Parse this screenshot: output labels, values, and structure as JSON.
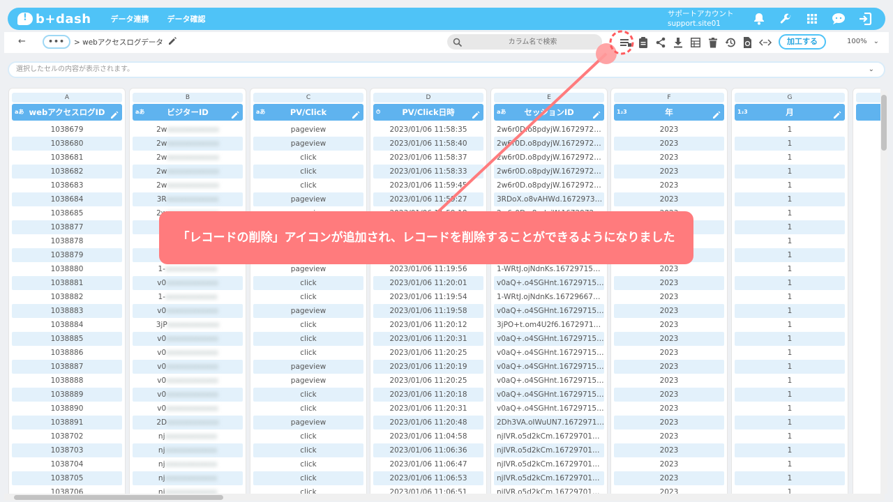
{
  "header": {
    "logo_text": "b+dash",
    "nav": [
      "データ連携",
      "データ確認"
    ],
    "account_name": "サポートアカウント",
    "account_site": "support.site01",
    "icons": [
      "bell-icon",
      "wrench-icon",
      "apps-grid-icon",
      "chat-support-icon",
      "logout-icon"
    ]
  },
  "toolbar": {
    "back_label": "←",
    "more_label": "•••",
    "breadcrumb": "> webアクセスログデータ",
    "search_placeholder": "カラム名で検索",
    "tool_icons": [
      "record-delete-icon",
      "clipboard-icon",
      "share-icon",
      "download-icon",
      "table-view-icon",
      "trash-icon",
      "history-icon",
      "refresh-file-icon",
      "code-icon"
    ],
    "process_label": "加工する",
    "zoom": "100%"
  },
  "cell_bar": {
    "placeholder": "選択したセルの内容が表示されます。"
  },
  "accent_colors": {
    "header_blue": "#4fc3f7",
    "column_header": "#5fb3ef",
    "callout": "#ff7b7d"
  },
  "grid": {
    "columns": [
      {
        "letter": "A",
        "type": "aあ",
        "name": "webアクセスログID"
      },
      {
        "letter": "B",
        "type": "aあ",
        "name": "ビジターID"
      },
      {
        "letter": "C",
        "type": "aあ",
        "name": "PV/Click"
      },
      {
        "letter": "D",
        "type": "⏱",
        "name": "PV/Click日時"
      },
      {
        "letter": "E",
        "type": "aあ",
        "name": "セッションID"
      },
      {
        "letter": "F",
        "type": "1₂3",
        "name": "年"
      },
      {
        "letter": "G",
        "type": "1₂3",
        "name": "月"
      }
    ],
    "rows": [
      [
        "1038679",
        "2w",
        "pageview",
        "2023/01/06 11:58:35",
        "2w6r0D.o8pdyjW.167297213...",
        "2023",
        "1"
      ],
      [
        "1038680",
        "2w",
        "pageview",
        "2023/01/06 11:58:40",
        "2w6r0D.o8pdyjW.167297213...",
        "2023",
        "1"
      ],
      [
        "1038681",
        "2w",
        "click",
        "2023/01/06 11:58:37",
        "2w6r0D.o8pdyjW.167297213...",
        "2023",
        "1"
      ],
      [
        "1038682",
        "2w",
        "click",
        "2023/01/06 11:58:33",
        "2w6r0D.o8pdyjW.167297213...",
        "2023",
        "1"
      ],
      [
        "1038683",
        "2w",
        "click",
        "2023/01/06 11:59:45",
        "2w6r0D.o8pdyjW.167297213...",
        "2023",
        "1"
      ],
      [
        "1038684",
        "3R",
        "pageview",
        "2023/01/06 11:59:27",
        "3RDoX.o8vAHWd.167297394...",
        "2023",
        "1"
      ],
      [
        "1038685",
        "2w",
        "pageview",
        "2023/01/06 11:59:18",
        "2w6r0D.o8pdyjW.167297213...",
        "2023",
        "1"
      ],
      [
        "1038877",
        "",
        "",
        "",
        "",
        "",
        "1"
      ],
      [
        "1038878",
        "",
        "",
        "",
        "",
        "",
        "1"
      ],
      [
        "1038879",
        "",
        "",
        "",
        "",
        "",
        "1"
      ],
      [
        "1038880",
        "1-",
        "pageview",
        "2023/01/06 11:19:56",
        "1-WRtJ.ojNdnKs.167297158...",
        "2023",
        "1"
      ],
      [
        "1038881",
        "v0",
        "click",
        "2023/01/06 11:20:01",
        "v0aQ+.o4SGHnt.167297159...",
        "2023",
        "1"
      ],
      [
        "1038882",
        "1-",
        "click",
        "2023/01/06 11:19:54",
        "1-WRtJ.ojNdnKs.167296672...",
        "2023",
        "1"
      ],
      [
        "1038883",
        "v0",
        "pageview",
        "2023/01/06 11:19:58",
        "v0aQ+.o4SGHnt.167297159...",
        "2023",
        "1"
      ],
      [
        "1038884",
        "3jP",
        "click",
        "2023/01/06 11:20:12",
        "3jPO+t.om4U2f6.16729715...",
        "2023",
        "1"
      ],
      [
        "1038885",
        "v0",
        "click",
        "2023/01/06 11:20:31",
        "v0aQ+.o4SGHnt.167297159...",
        "2023",
        "1"
      ],
      [
        "1038886",
        "v0",
        "click",
        "2023/01/06 11:20:25",
        "v0aQ+.o4SGHnt.167297159...",
        "2023",
        "1"
      ],
      [
        "1038887",
        "v0",
        "pageview",
        "2023/01/06 11:20:19",
        "v0aQ+.o4SGHnt.167297159...",
        "2023",
        "1"
      ],
      [
        "1038888",
        "v0",
        "pageview",
        "2023/01/06 11:20:25",
        "v0aQ+.o4SGHnt.167297159...",
        "2023",
        "1"
      ],
      [
        "1038889",
        "v0",
        "click",
        "2023/01/06 11:20:18",
        "v0aQ+.o4SGHnt.167297159...",
        "2023",
        "1"
      ],
      [
        "1038890",
        "v0",
        "click",
        "2023/01/06 11:20:31",
        "v0aQ+.o4SGHnt.167297159...",
        "2023",
        "1"
      ],
      [
        "1038891",
        "2D",
        "pageview",
        "2023/01/06 11:20:48",
        "2Dh3VA.oIWuUN7.16729716...",
        "2023",
        "1"
      ],
      [
        "1038702",
        "nj",
        "click",
        "2023/01/06 11:04:58",
        "njIVR.o5d2kCm.1672970131...",
        "2023",
        "1"
      ],
      [
        "1038703",
        "nj",
        "click",
        "2023/01/06 11:06:36",
        "njIVR.o5d2kCm.1672970131...",
        "2023",
        "1"
      ],
      [
        "1038704",
        "nj",
        "click",
        "2023/01/06 11:06:47",
        "njIVR.o5d2kCm.1672970131...",
        "2023",
        "1"
      ],
      [
        "1038705",
        "nj",
        "click",
        "2023/01/06 11:06:53",
        "njIVR.o5d2kCm.1672970131...",
        "2023",
        "1"
      ],
      [
        "1038706",
        "nj",
        "click",
        "2023/01/06 11:06:51",
        "njIVR.o5d2kCm.1672970131...",
        "2023",
        "1"
      ]
    ]
  },
  "callout": {
    "text": "「レコードの削除」アイコンが追加され、レコードを削除することができるようになりました"
  }
}
